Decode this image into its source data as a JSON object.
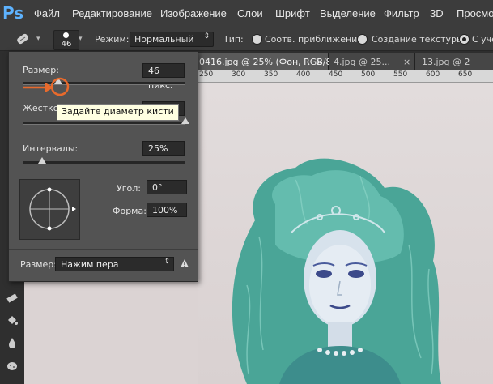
{
  "app": {
    "logo": "Ps"
  },
  "menu": [
    "Файл",
    "Редактирование",
    "Изображение",
    "Слои",
    "Шрифт",
    "Выделение",
    "Фильтр",
    "3D",
    "Просмо"
  ],
  "options_bar": {
    "brush_size": "46",
    "mode_label": "Режим:",
    "mode_value": "Нормальный",
    "type_label": "Тип:",
    "radio1_label": "Соотв. приближения",
    "radio2_label": "Создание текстуры",
    "radio3_label": "С учет"
  },
  "tabs": [
    {
      "label": "0416.jpg @ 25% (Фон, RGB/8) *",
      "close": "×",
      "active": true
    },
    {
      "label": "4.jpg @ 25...",
      "close": "×",
      "active": false
    },
    {
      "label": "13.jpg @ 2",
      "close": "",
      "active": false
    }
  ],
  "ruler_ticks": [
    "250",
    "300",
    "350",
    "400",
    "450",
    "500",
    "550",
    "600",
    "650"
  ],
  "brush_panel": {
    "size_label": "Размер:",
    "size_value": "46 пикс.",
    "size_fraction": 0.22,
    "hardness_label": "Жесткость:",
    "hardness_value": "",
    "hardness_fraction": 1.0,
    "spacing_label": "Интервалы:",
    "spacing_value": "25%",
    "spacing_fraction": 0.12,
    "angle_label": "Угол:",
    "angle_value": "0°",
    "roundness_label": "Форма:",
    "roundness_value": "100%",
    "pressure_label": "Размер:",
    "pressure_value": "Нажим пера"
  },
  "tooltip": "Задайте диаметр кисти",
  "colors": {
    "accent_arrow": "#e86a2c",
    "tooltip_bg": "#ffffe1"
  }
}
